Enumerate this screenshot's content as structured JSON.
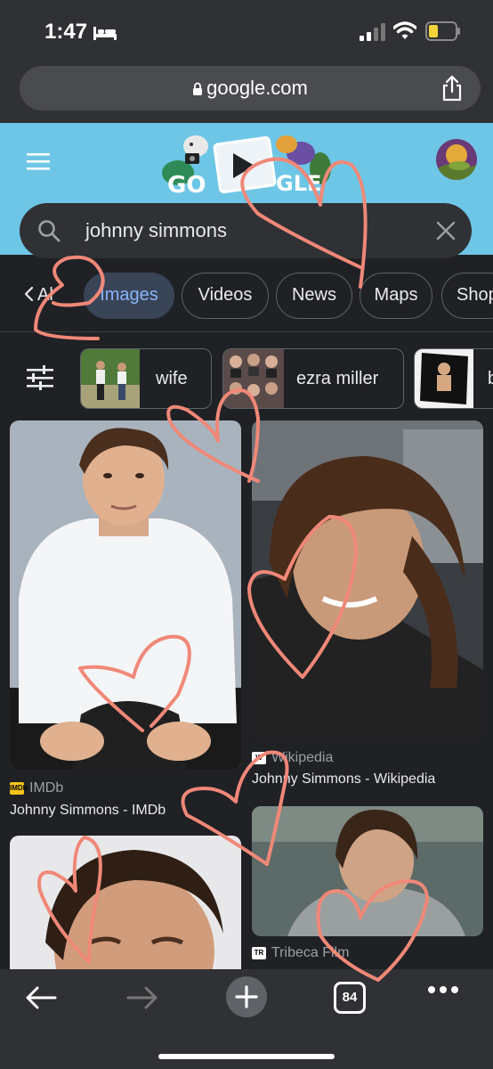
{
  "status": {
    "time": "1:47"
  },
  "browser": {
    "url": "google.com",
    "tab_count": "84"
  },
  "search": {
    "query": "johnny simmons"
  },
  "tabs": [
    {
      "label": "All",
      "display": "Al"
    },
    {
      "label": "Images"
    },
    {
      "label": "Videos"
    },
    {
      "label": "News"
    },
    {
      "label": "Maps"
    },
    {
      "label": "Shop"
    }
  ],
  "related": [
    {
      "label": "wife"
    },
    {
      "label": "ezra miller"
    },
    {
      "label": "b"
    }
  ],
  "results": [
    {
      "source": "IMDb",
      "title": "Johnny Simmons - IMDb"
    },
    {
      "source": "Wikipedia",
      "title": "Johnny Simmons - Wikipedia"
    },
    {
      "source": "Tribeca Film",
      "title": ""
    }
  ],
  "colors": {
    "header_bg": "#6ec6e6",
    "active_tab_text": "#8ab4f8",
    "drawing_stroke": "#f08878"
  }
}
